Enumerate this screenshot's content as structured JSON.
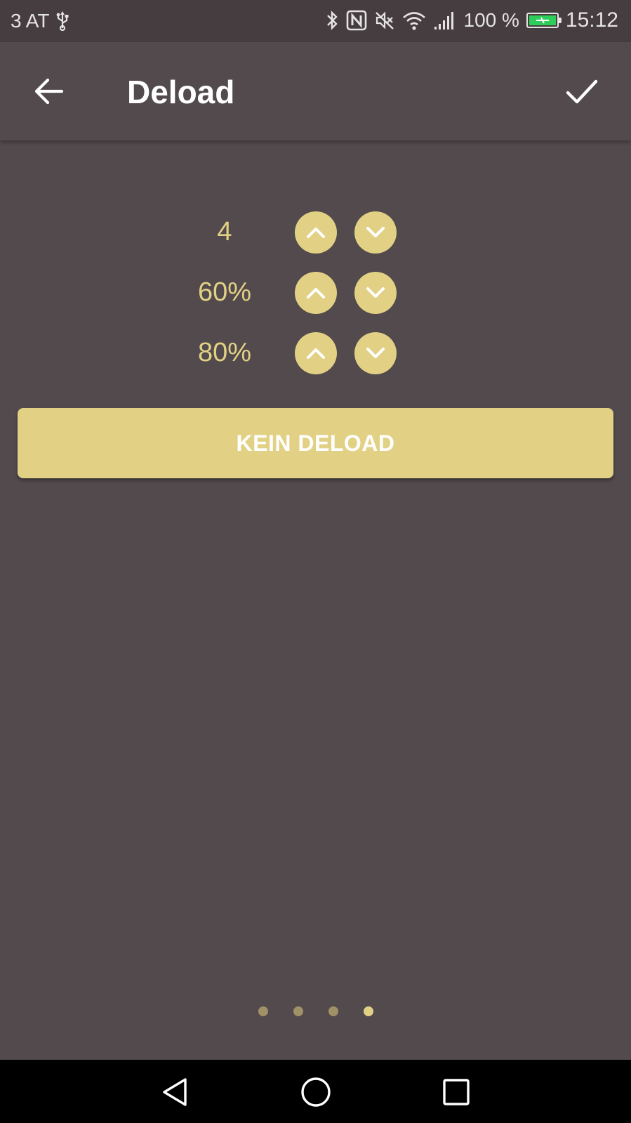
{
  "status_bar": {
    "carrier": "3 AT",
    "battery_percent": "100 %",
    "time": "15:12",
    "icons": [
      "usb-icon",
      "bluetooth-icon",
      "nfc-icon",
      "mute-icon",
      "wifi-icon",
      "signal-icon",
      "battery-charging-icon"
    ],
    "battery_color": "#2ecc58"
  },
  "header": {
    "title": "Deload",
    "back_icon": "arrow-left-icon",
    "confirm_icon": "check-icon"
  },
  "settings": {
    "rows": [
      {
        "value": "4"
      },
      {
        "value": "60%"
      },
      {
        "value": "80%"
      }
    ],
    "up_icon": "chevron-up-icon",
    "down_icon": "chevron-down-icon"
  },
  "actions": {
    "kein_deload_label": "KEIN DELOAD"
  },
  "pager": {
    "count": 4,
    "active_index": 3
  },
  "colors": {
    "background": "#524a4c",
    "accent": "#e2d185",
    "inactive_dot": "#a09166"
  },
  "nav_bar": {
    "icons": [
      "back-triangle-icon",
      "home-circle-icon",
      "recents-square-icon"
    ]
  }
}
